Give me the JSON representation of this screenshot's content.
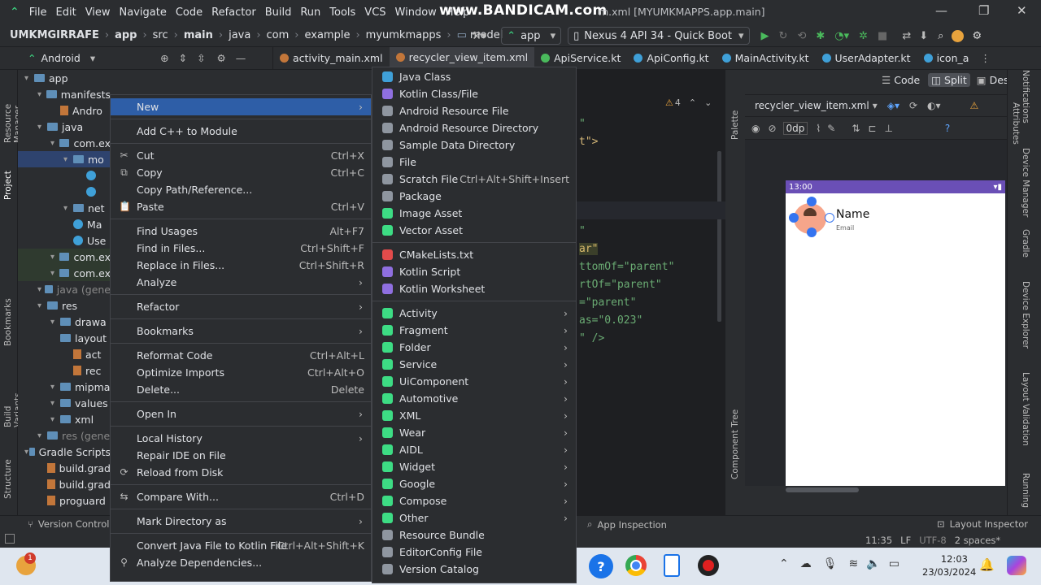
{
  "menubar": {
    "items": [
      "File",
      "Edit",
      "View",
      "Navigate",
      "Code",
      "Refactor",
      "Build",
      "Run",
      "Tools",
      "VCS",
      "Window",
      "Help"
    ],
    "watermark": "www.BANDICAM.com",
    "title_tail": "m.xml [MYUMKMAPPS.app.main]"
  },
  "navbar": {
    "crumbs": [
      "UMKMGIRRAFE",
      "app",
      "src",
      "main",
      "java",
      "com",
      "example",
      "myumkmapps",
      "model"
    ],
    "run_config": "app",
    "device": "Nexus 4 API 34 - Quick Boot"
  },
  "tabs": [
    "activity_main.xml",
    "recycler_view_item.xml",
    "ApiService.kt",
    "ApiConfig.kt",
    "MainActivity.kt",
    "UserAdapter.kt",
    "icon_a"
  ],
  "view_modes": {
    "code": "Code",
    "split": "Split",
    "design": "Design"
  },
  "project_view": "Android",
  "left_strip": [
    "Resource Manager",
    "Project",
    "Bookmarks",
    "Build Variants",
    "Structure"
  ],
  "right_strip": [
    "Notifications",
    "Attributes",
    "Device Manager",
    "Gradle",
    "Device Explorer",
    "Layout Validation",
    "Running"
  ],
  "tree": [
    {
      "indent": 0,
      "label": "app",
      "type": "folder"
    },
    {
      "indent": 1,
      "label": "manifests",
      "type": "folder"
    },
    {
      "indent": 2,
      "label": "Andro",
      "type": "file"
    },
    {
      "indent": 1,
      "label": "java",
      "type": "folder"
    },
    {
      "indent": 2,
      "label": "com.ex",
      "type": "folder"
    },
    {
      "indent": 3,
      "label": "mo",
      "type": "folder"
    },
    {
      "indent": 4,
      "label": "",
      "type": "k"
    },
    {
      "indent": 4,
      "label": "",
      "type": "k"
    },
    {
      "indent": 3,
      "label": "net",
      "type": "folder"
    },
    {
      "indent": 3,
      "label": "Ma",
      "type": "k"
    },
    {
      "indent": 3,
      "label": "Use",
      "type": "k"
    },
    {
      "indent": 2,
      "label": "com.ex",
      "type": "folder"
    },
    {
      "indent": 2,
      "label": "com.ex",
      "type": "folder"
    },
    {
      "indent": 1,
      "label": "java (gene",
      "type": "folder"
    },
    {
      "indent": 1,
      "label": "res",
      "type": "folder"
    },
    {
      "indent": 2,
      "label": "drawa",
      "type": "folder"
    },
    {
      "indent": 2,
      "label": "layout",
      "type": "folder"
    },
    {
      "indent": 3,
      "label": "act",
      "type": "file"
    },
    {
      "indent": 3,
      "label": "rec",
      "type": "file"
    },
    {
      "indent": 2,
      "label": "mipma",
      "type": "folder"
    },
    {
      "indent": 2,
      "label": "values",
      "type": "folder"
    },
    {
      "indent": 2,
      "label": "xml",
      "type": "folder"
    },
    {
      "indent": 1,
      "label": "res (gene",
      "type": "folder"
    },
    {
      "indent": 0,
      "label": "Gradle Scripts",
      "type": "folder"
    },
    {
      "indent": 1,
      "label": "build.grad",
      "type": "file"
    },
    {
      "indent": 1,
      "label": "build.grad",
      "type": "file"
    },
    {
      "indent": 1,
      "label": "proguard",
      "type": "file"
    }
  ],
  "context_menu": [
    {
      "label": "New",
      "arrow": true,
      "selected": true
    },
    {
      "sep": true
    },
    {
      "label": "Add C++ to Module"
    },
    {
      "sep": true
    },
    {
      "label": "Cut",
      "shortcut": "Ctrl+X",
      "icon": "cut-icon"
    },
    {
      "label": "Copy",
      "shortcut": "Ctrl+C",
      "icon": "copy-icon"
    },
    {
      "label": "Copy Path/Reference..."
    },
    {
      "label": "Paste",
      "shortcut": "Ctrl+V",
      "icon": "paste-icon"
    },
    {
      "sep": true
    },
    {
      "label": "Find Usages",
      "shortcut": "Alt+F7"
    },
    {
      "label": "Find in Files...",
      "shortcut": "Ctrl+Shift+F"
    },
    {
      "label": "Replace in Files...",
      "shortcut": "Ctrl+Shift+R"
    },
    {
      "label": "Analyze",
      "arrow": true
    },
    {
      "sep": true
    },
    {
      "label": "Refactor",
      "arrow": true
    },
    {
      "sep": true
    },
    {
      "label": "Bookmarks",
      "arrow": true
    },
    {
      "sep": true
    },
    {
      "label": "Reformat Code",
      "shortcut": "Ctrl+Alt+L"
    },
    {
      "label": "Optimize Imports",
      "shortcut": "Ctrl+Alt+O"
    },
    {
      "label": "Delete...",
      "shortcut": "Delete"
    },
    {
      "sep": true
    },
    {
      "label": "Open In",
      "arrow": true
    },
    {
      "sep": true
    },
    {
      "label": "Local History",
      "arrow": true
    },
    {
      "label": "Repair IDE on File"
    },
    {
      "label": "Reload from Disk",
      "icon": "reload-icon"
    },
    {
      "sep": true
    },
    {
      "label": "Compare With...",
      "shortcut": "Ctrl+D",
      "icon": "compare-icon"
    },
    {
      "sep": true
    },
    {
      "label": "Mark Directory as",
      "arrow": true
    },
    {
      "sep": true
    },
    {
      "label": "Convert Java File to Kotlin File",
      "shortcut": "Ctrl+Alt+Shift+K"
    },
    {
      "label": "Analyze Dependencies...",
      "icon": "analyze-icon"
    }
  ],
  "sub_menu": [
    {
      "label": "Java Class",
      "color": "#3fa0d8"
    },
    {
      "label": "Kotlin Class/File",
      "color": "#8f6fe0"
    },
    {
      "label": "Android Resource File",
      "color": "#8f96a0"
    },
    {
      "label": "Android Resource Directory",
      "color": "#8f96a0"
    },
    {
      "label": "Sample Data Directory",
      "color": "#8f96a0"
    },
    {
      "label": "File",
      "color": "#8f96a0"
    },
    {
      "label": "Scratch File",
      "shortcut": "Ctrl+Alt+Shift+Insert",
      "color": "#8f96a0"
    },
    {
      "label": "Package",
      "color": "#8f96a0"
    },
    {
      "label": "Image Asset",
      "color": "#3ddc84"
    },
    {
      "label": "Vector Asset",
      "color": "#3ddc84"
    },
    {
      "sep": true
    },
    {
      "label": "CMakeLists.txt",
      "color": "#e24b4b"
    },
    {
      "label": "Kotlin Script",
      "color": "#8f6fe0"
    },
    {
      "label": "Kotlin Worksheet",
      "color": "#8f6fe0"
    },
    {
      "sep": true
    },
    {
      "label": "Activity",
      "arrow": true,
      "color": "#3ddc84"
    },
    {
      "label": "Fragment",
      "arrow": true,
      "color": "#3ddc84"
    },
    {
      "label": "Folder",
      "arrow": true,
      "color": "#3ddc84"
    },
    {
      "label": "Service",
      "arrow": true,
      "color": "#3ddc84"
    },
    {
      "label": "UiComponent",
      "arrow": true,
      "color": "#3ddc84"
    },
    {
      "label": "Automotive",
      "arrow": true,
      "color": "#3ddc84"
    },
    {
      "label": "XML",
      "arrow": true,
      "color": "#3ddc84"
    },
    {
      "label": "Wear",
      "arrow": true,
      "color": "#3ddc84"
    },
    {
      "label": "AIDL",
      "arrow": true,
      "color": "#3ddc84"
    },
    {
      "label": "Widget",
      "arrow": true,
      "color": "#3ddc84"
    },
    {
      "label": "Google",
      "arrow": true,
      "color": "#3ddc84"
    },
    {
      "label": "Compose",
      "arrow": true,
      "color": "#3ddc84"
    },
    {
      "label": "Other",
      "arrow": true,
      "color": "#3ddc84"
    },
    {
      "label": "Resource Bundle",
      "color": "#8f96a0"
    },
    {
      "label": "EditorConfig File",
      "color": "#8f96a0"
    },
    {
      "label": "Version Catalog",
      "color": "#8f96a0"
    }
  ],
  "editor": {
    "warn_count": "4",
    "lines": [
      {
        "t": "\""
      },
      {
        "t": "t\">"
      },
      {
        "t": ""
      },
      {
        "t": ""
      },
      {
        "t": ""
      },
      {
        "t": ""
      },
      {
        "t": "\""
      },
      {
        "t": "ar\"",
        "hl": true
      },
      {
        "t": "ttomOf=\"parent\""
      },
      {
        "t": "rtOf=\"parent\""
      },
      {
        "t": "=\"parent\""
      },
      {
        "t": "as=\"0.023\""
      },
      {
        "t": "\" />"
      }
    ]
  },
  "design": {
    "file": "recycler_view_item.xml",
    "zoom": "0dp",
    "phone_time": "13:00",
    "name_text": "Name",
    "email_text": "Email",
    "palette": "Palette",
    "component_tree": "Component Tree"
  },
  "status": {
    "version_control": "Version Control",
    "app_inspection": "App Inspection",
    "layout_inspector": "Layout Inspector",
    "pos": "11:35",
    "le": "LF",
    "enc": "UTF-8",
    "indent": "2 spaces*"
  },
  "taskbar": {
    "time": "12:03",
    "date": "23/03/2024",
    "badge": "1"
  }
}
